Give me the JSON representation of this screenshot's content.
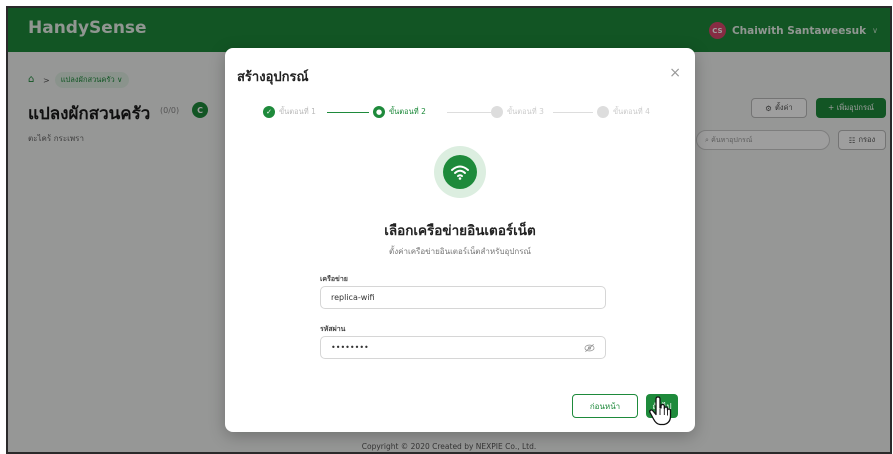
{
  "app": {
    "brand": "HandySense"
  },
  "user": {
    "initials": "CS",
    "name": "Chaiwith Santaweesuk"
  },
  "page": {
    "breadcrumb_current": "แปลงผักสวนครัว ∨",
    "title": "แปลงผักสวนครัว",
    "count": "(0/0)",
    "badge": "C",
    "subtitle": "ตะไคร้ กระเพรา",
    "settings_label": "ตั้งค่า",
    "add_device_label": "+ เพิ่มอุปกรณ์",
    "search_placeholder": "ค้นหาอุปกรณ์",
    "filter_label": "กรอง",
    "footer": "Copyright © 2020 Created by NEXPIE Co., Ltd."
  },
  "modal": {
    "title": "สร้างอุปกรณ์",
    "close": "×",
    "steps": [
      {
        "label": "ขั้นตอนที่ 1",
        "state": "done"
      },
      {
        "label": "ขั้นตอนที่ 2",
        "state": "active"
      },
      {
        "label": "ขั้นตอนที่ 3",
        "state": "todo"
      },
      {
        "label": "ขั้นตอนที่ 4",
        "state": "todo"
      }
    ],
    "heading": "เลือกเครือข่ายอินเตอร์เน็ต",
    "description": "ตั้งค่าเครือข่ายอินเตอร์เน็ตสำหรับอุปกรณ์",
    "network_label": "เครือข่าย",
    "network_value": "replica-wifi",
    "password_label": "รหัสผ่าน",
    "password_value": "••••••••",
    "back_label": "ก่อนหน้า",
    "next_label": "ถัดไป"
  },
  "colors": {
    "primary": "#1e8a3b",
    "topbar": "#1e8a3b",
    "avatar": "#d9486d"
  },
  "icons": [
    "home-icon",
    "gear-icon",
    "plus-icon",
    "search-icon",
    "filter-icon",
    "check-icon",
    "wifi-icon",
    "eye-off-icon",
    "hand-cursor-icon",
    "close-icon"
  ]
}
